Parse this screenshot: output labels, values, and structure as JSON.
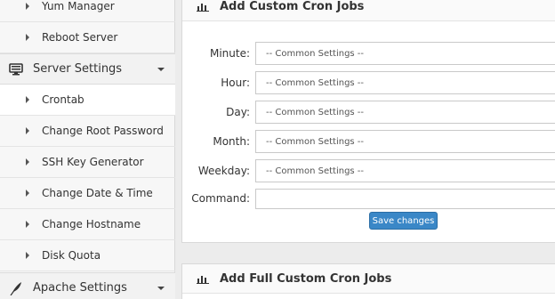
{
  "sidebar": {
    "top_items": [
      {
        "label": "Yum Manager"
      },
      {
        "label": "Reboot Server"
      }
    ],
    "server_settings": {
      "label": "Server Settings",
      "icon": "monitor-icon",
      "items": [
        {
          "label": "Crontab"
        },
        {
          "label": "Change Root Password"
        },
        {
          "label": "SSH Key Generator"
        },
        {
          "label": "Change Date & Time"
        },
        {
          "label": "Change Hostname"
        },
        {
          "label": "Disk Quota"
        }
      ]
    },
    "apache_settings": {
      "label": "Apache Settings",
      "icon": "feather-icon"
    }
  },
  "panel_custom": {
    "title": "Add Custom Cron Jobs",
    "fields": [
      {
        "label": "Minute:",
        "value": "-- Common Settings --"
      },
      {
        "label": "Hour:",
        "value": "-- Common Settings --"
      },
      {
        "label": "Day:",
        "value": "-- Common Settings --"
      },
      {
        "label": "Month:",
        "value": "-- Common Settings --"
      },
      {
        "label": "Weekday:",
        "value": "-- Common Settings --"
      }
    ],
    "command_label": "Command:",
    "command_value": "",
    "save_label": "Save changes"
  },
  "panel_full": {
    "title": "Add Full Custom Cron Jobs"
  },
  "colors": {
    "accent": "#3a87c7",
    "background": "#ececec",
    "sidebar": "#f7f7f7"
  }
}
